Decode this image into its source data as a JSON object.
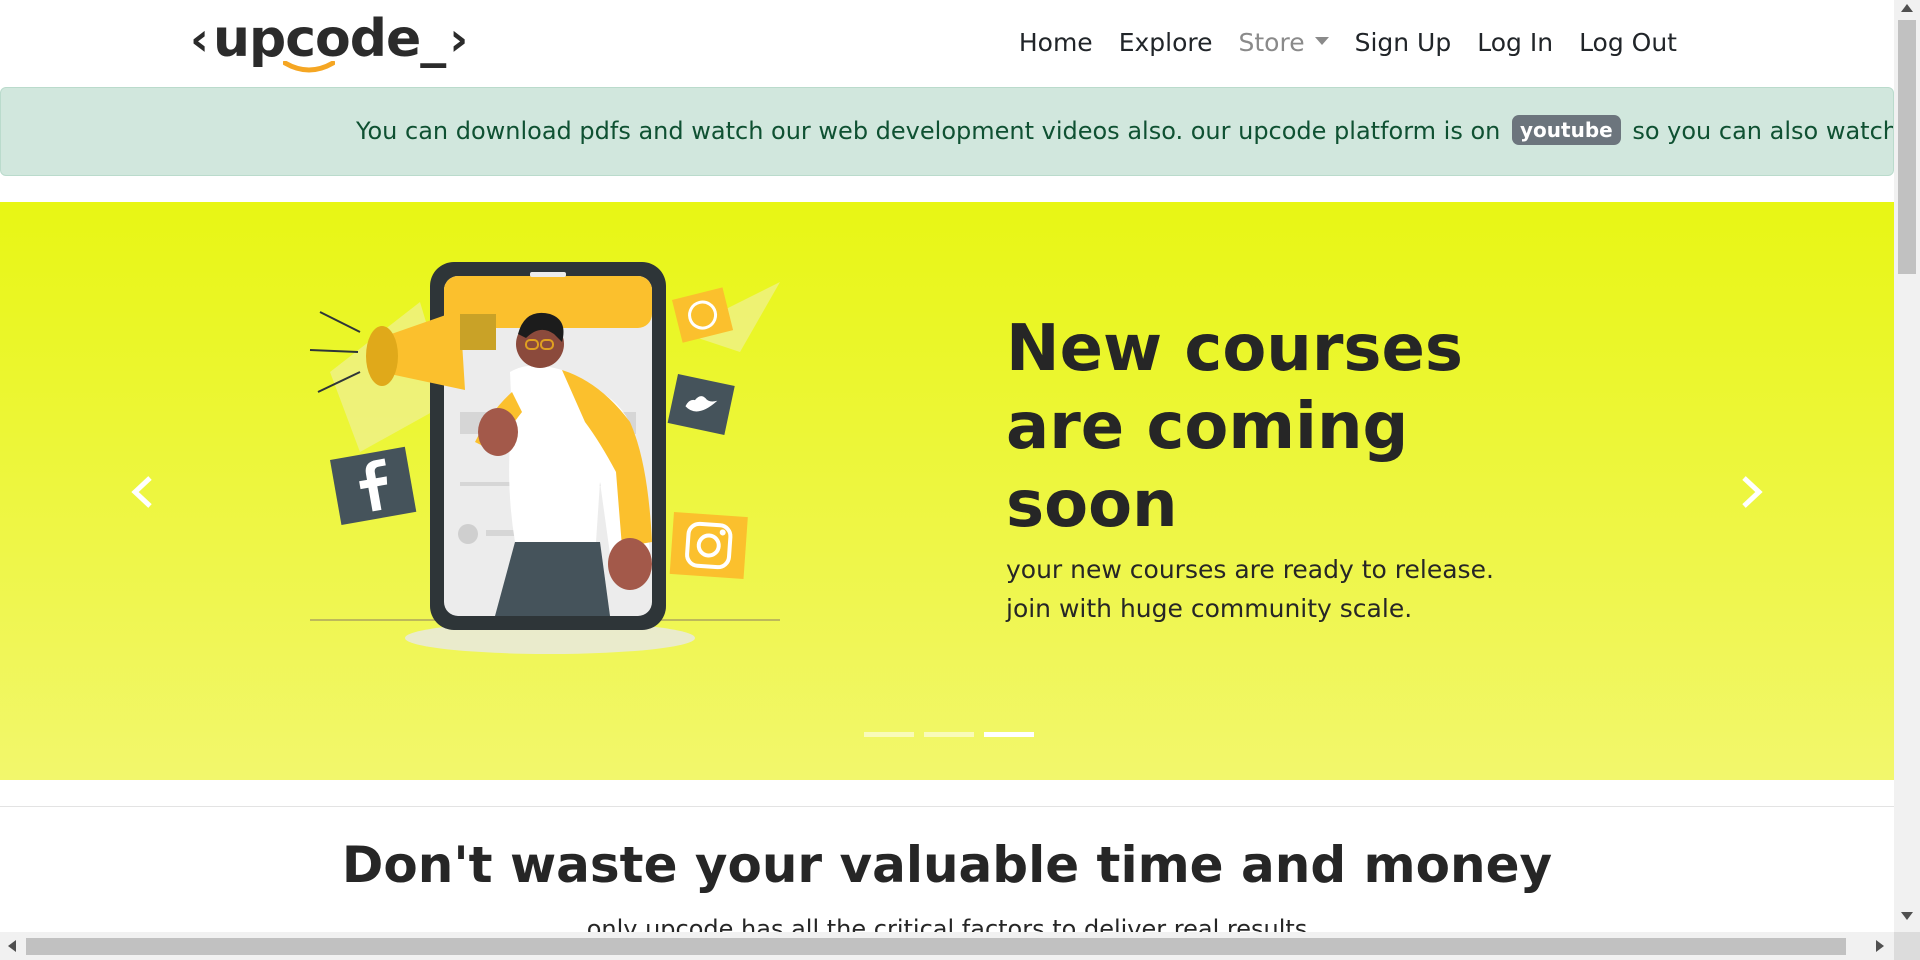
{
  "brand": {
    "name": "upcode_",
    "accent": "#f5a623"
  },
  "nav": {
    "items": [
      {
        "label": "Home"
      },
      {
        "label": "Explore"
      },
      {
        "label": "Store",
        "dropdown": true
      },
      {
        "label": "Sign Up"
      },
      {
        "label": "Log In"
      },
      {
        "label": "Log Out"
      }
    ]
  },
  "alert": {
    "text_before": "You can download pdfs and watch our web development videos also. our upcode platform is on",
    "badge": "youtube",
    "text_after": "so you can also watch our",
    "bg_color": "#d1e7dd",
    "text_color": "#0f5132"
  },
  "carousel": {
    "heading": "New courses are coming soon",
    "line1": "your new courses are ready to release.",
    "line2": "join with huge community scale.",
    "indicator_count": 3,
    "active_indicator": 3,
    "bg_color": "#e8f614",
    "icons": [
      "megaphone-icon",
      "whatsapp-icon",
      "twitter-icon",
      "facebook-icon",
      "instagram-icon"
    ]
  },
  "section": {
    "title": "Don't waste your valuable time and money",
    "subtitle": "only upcode has all the critical factors to deliver real results"
  }
}
